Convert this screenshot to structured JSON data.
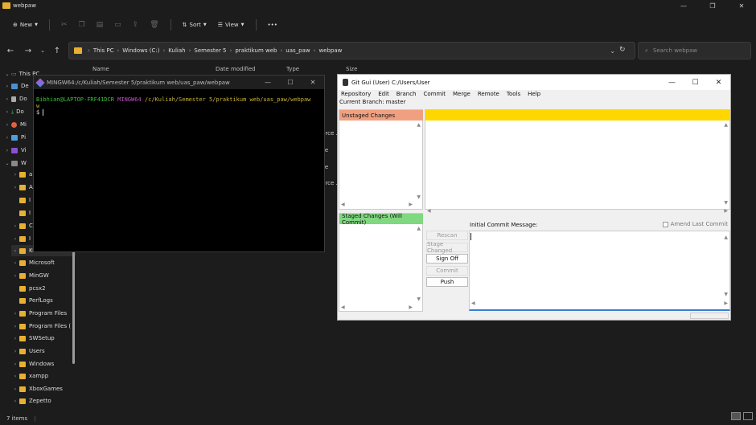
{
  "explorer": {
    "title": "webpaw",
    "toolbar": {
      "new_label": "New",
      "sort_label": "Sort",
      "view_label": "View",
      "more_label": "•••"
    },
    "address": [
      "This PC",
      "Windows (C:)",
      "Kuliah",
      "Semester 5",
      "praktikum web",
      "uas_paw",
      "webpaw"
    ],
    "search_placeholder": "Search webpaw",
    "columns": [
      "Name",
      "Date modified",
      "Type",
      "Size"
    ],
    "nav_top": [
      "This PC",
      "De",
      "Do",
      "Do",
      "Mi",
      "Pi",
      "Vi",
      "W"
    ],
    "nav_folders": [
      "a",
      "A",
      "I",
      "I",
      "C",
      "I",
      "Kuliah",
      "Microsoft",
      "MinGW",
      "pcsx2",
      "PerfLogs",
      "Program Files",
      "Program Files (",
      "SWSetup",
      "Users",
      "Windows",
      "xampp",
      "XboxGames",
      "Zepetto"
    ],
    "peek_types": [
      "urce ...",
      "ile",
      "ile",
      "urce ..."
    ],
    "status": "7 items"
  },
  "terminal": {
    "title": "MINGW64:/c/Kuliah/Semester 5/praktikum web/uas_paw/webpaw",
    "prompt_user": "Bibhian@LAPTOP-FRF41DCR",
    "prompt_env": "MINGW64",
    "prompt_path": "/c/Kuliah/Semester 5/praktikum web/uas_paw/webpaw",
    "wrap_char": "w",
    "prompt_symbol": "$"
  },
  "gitgui": {
    "title": "Git Gui (User) C:/Users/User",
    "menu": [
      "Repository",
      "Edit",
      "Branch",
      "Commit",
      "Merge",
      "Remote",
      "Tools",
      "Help"
    ],
    "current_branch": "Current Branch: master",
    "unstaged_header": "Unstaged Changes",
    "staged_header": "Staged Changes (Will Commit)",
    "commit_msg_label": "Initial Commit Message:",
    "amend_label": "Amend Last Commit",
    "buttons": {
      "rescan": "Rescan",
      "stage_changed": "Stage Changed",
      "sign_off": "Sign Off",
      "commit": "Commit",
      "push": "Push"
    },
    "colors": {
      "unstaged": "#f0a080",
      "staged": "#80d880",
      "diff_header": "#ffd700"
    }
  }
}
